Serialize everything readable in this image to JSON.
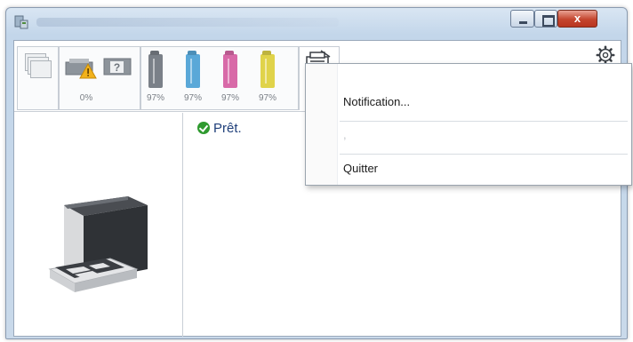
{
  "window": {
    "close_glyph": "x"
  },
  "toolbar": {
    "status_pct": "0%",
    "toners": [
      {
        "color": "#7a8088",
        "pct": "97%",
        "level": 0.97
      },
      {
        "color": "#5aa8d8",
        "pct": "97%",
        "level": 0.97
      },
      {
        "color": "#d86aa8",
        "pct": "97%",
        "level": 0.97
      },
      {
        "color": "#e0d34a",
        "pct": "97%",
        "level": 0.97
      }
    ]
  },
  "status": {
    "text": "Prêt."
  },
  "context_menu": {
    "items": [
      {
        "label": "Notification..."
      },
      {
        "label": ","
      },
      {
        "label": "Quitter"
      }
    ]
  },
  "colors": {
    "status_ok": "#2f9a2f",
    "status_text": "#1f3f7a",
    "warning": "#f2b21b"
  }
}
